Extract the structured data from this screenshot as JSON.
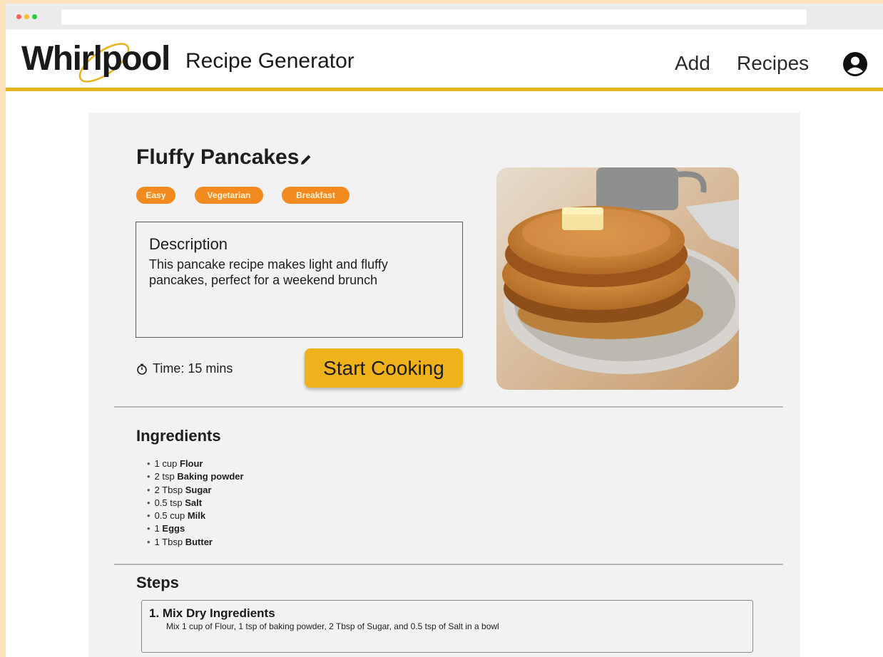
{
  "header": {
    "logo": "Whirlpool",
    "app_title": "Recipe Generator",
    "nav": {
      "add": "Add",
      "recipes": "Recipes"
    },
    "account_icon": "account-circle-icon",
    "accent_color": "#e6b31e"
  },
  "recipe": {
    "title": "Fluffy Pancakes",
    "tags": [
      "Easy",
      "Vegetarian",
      "Breakfast"
    ],
    "tag_color": "#f28a1f",
    "description": {
      "heading": "Description",
      "text": "This pancake recipe makes light and fluffy pancakes, perfect for a weekend brunch"
    },
    "time": "Time: 15 mins",
    "start_button": "Start Cooking",
    "start_button_color": "#f0b21a"
  },
  "ingredients": {
    "title": "Ingredients",
    "items": [
      {
        "qty": "1 cup",
        "name": "Flour"
      },
      {
        "qty": "2 tsp",
        "name": "Baking powder"
      },
      {
        "qty": "2 Tbsp",
        "name": "Sugar"
      },
      {
        "qty": "0.5 tsp",
        "name": "Salt"
      },
      {
        "qty": "0.5 cup",
        "name": "Milk"
      },
      {
        "qty": "1",
        "name": "Eggs"
      },
      {
        "qty": "1 Tbsp",
        "name": "Butter"
      }
    ]
  },
  "steps": {
    "title": "Steps",
    "items": [
      {
        "title": "1. Mix Dry Ingredients",
        "text": "Mix 1 cup of Flour, 1 tsp of baking powder, 2 Tbsp of Sugar, and 0.5 tsp of Salt in a bowl"
      }
    ]
  }
}
